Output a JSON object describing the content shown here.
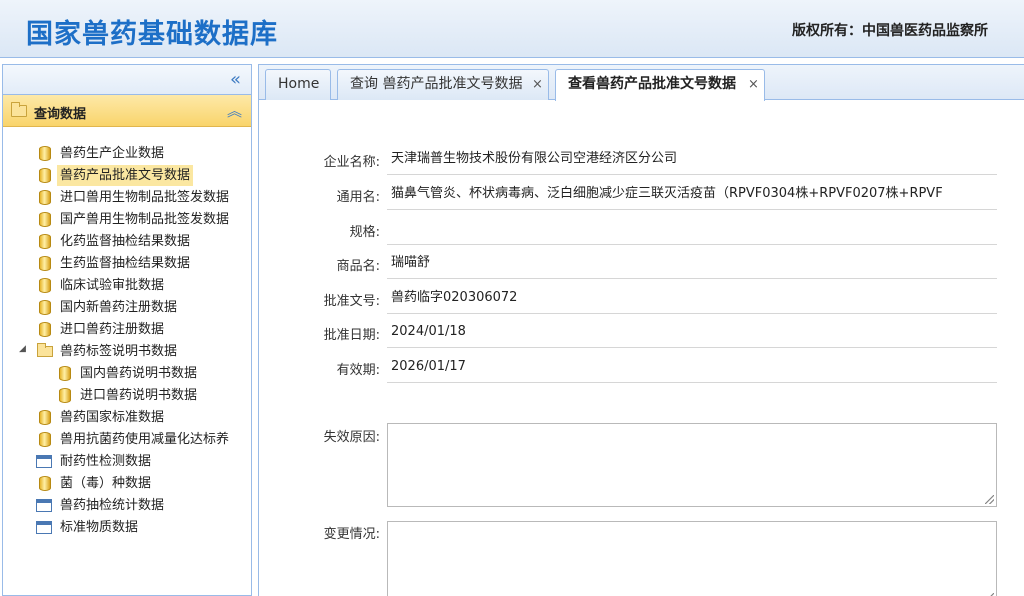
{
  "header": {
    "title": "国家兽药基础数据库",
    "copyright": "版权所有：中国兽医药品监察所"
  },
  "sidebar": {
    "collapse_label": "«",
    "section_title": "查询数据",
    "section_toggle": "︽",
    "items": [
      {
        "label": "兽药生产企业数据",
        "icon": "database-icon"
      },
      {
        "label": "兽药产品批准文号数据",
        "icon": "database-icon",
        "selected": true
      },
      {
        "label": "进口兽用生物制品批签发数据",
        "icon": "database-icon"
      },
      {
        "label": "国产兽用生物制品批签发数据",
        "icon": "database-icon"
      },
      {
        "label": "化药监督抽检结果数据",
        "icon": "database-icon"
      },
      {
        "label": "生药监督抽检结果数据",
        "icon": "database-icon"
      },
      {
        "label": "临床试验审批数据",
        "icon": "database-icon"
      },
      {
        "label": "国内新兽药注册数据",
        "icon": "database-icon"
      },
      {
        "label": "进口兽药注册数据",
        "icon": "database-icon"
      },
      {
        "label": "兽药标签说明书数据",
        "icon": "folder-icon",
        "expanded": true
      },
      {
        "label": "国内兽药说明书数据",
        "icon": "database-icon",
        "child": true
      },
      {
        "label": "进口兽药说明书数据",
        "icon": "database-icon",
        "child": true
      },
      {
        "label": "兽药国家标准数据",
        "icon": "database-icon"
      },
      {
        "label": "兽用抗菌药使用减量化达标养",
        "icon": "database-icon"
      },
      {
        "label": "耐药性检测数据",
        "icon": "form-icon"
      },
      {
        "label": "菌（毒）种数据",
        "icon": "database-icon"
      },
      {
        "label": "兽药抽检统计数据",
        "icon": "form-icon"
      },
      {
        "label": "标准物质数据",
        "icon": "form-icon"
      }
    ]
  },
  "tabs": [
    {
      "label": "Home",
      "closable": false
    },
    {
      "label": "查询 兽药产品批准文号数据",
      "closable": true
    },
    {
      "label": "查看兽药产品批准文号数据",
      "closable": true,
      "active": true
    }
  ],
  "tab_close_glyph": "×",
  "form": {
    "fields": [
      {
        "label": "企业名称:",
        "value": "天津瑞普生物技术股份有限公司空港经济区分公司"
      },
      {
        "label": "通用名:",
        "value": "猫鼻气管炎、杯状病毒病、泛白细胞减少症三联灭活疫苗（RPVF0304株+RPVF0207株+RPVF"
      },
      {
        "label": "规格:",
        "value": ""
      },
      {
        "label": "商品名:",
        "value": "瑞喵舒"
      },
      {
        "label": "批准文号:",
        "value": "兽药临字020306072"
      },
      {
        "label": "批准日期:",
        "value": "2024/01/18"
      },
      {
        "label": "有效期:",
        "value": "2026/01/17"
      }
    ],
    "invalid_reason_label": "失效原因:",
    "invalid_reason_value": "",
    "change_label": "变更情况:",
    "change_value": ""
  }
}
